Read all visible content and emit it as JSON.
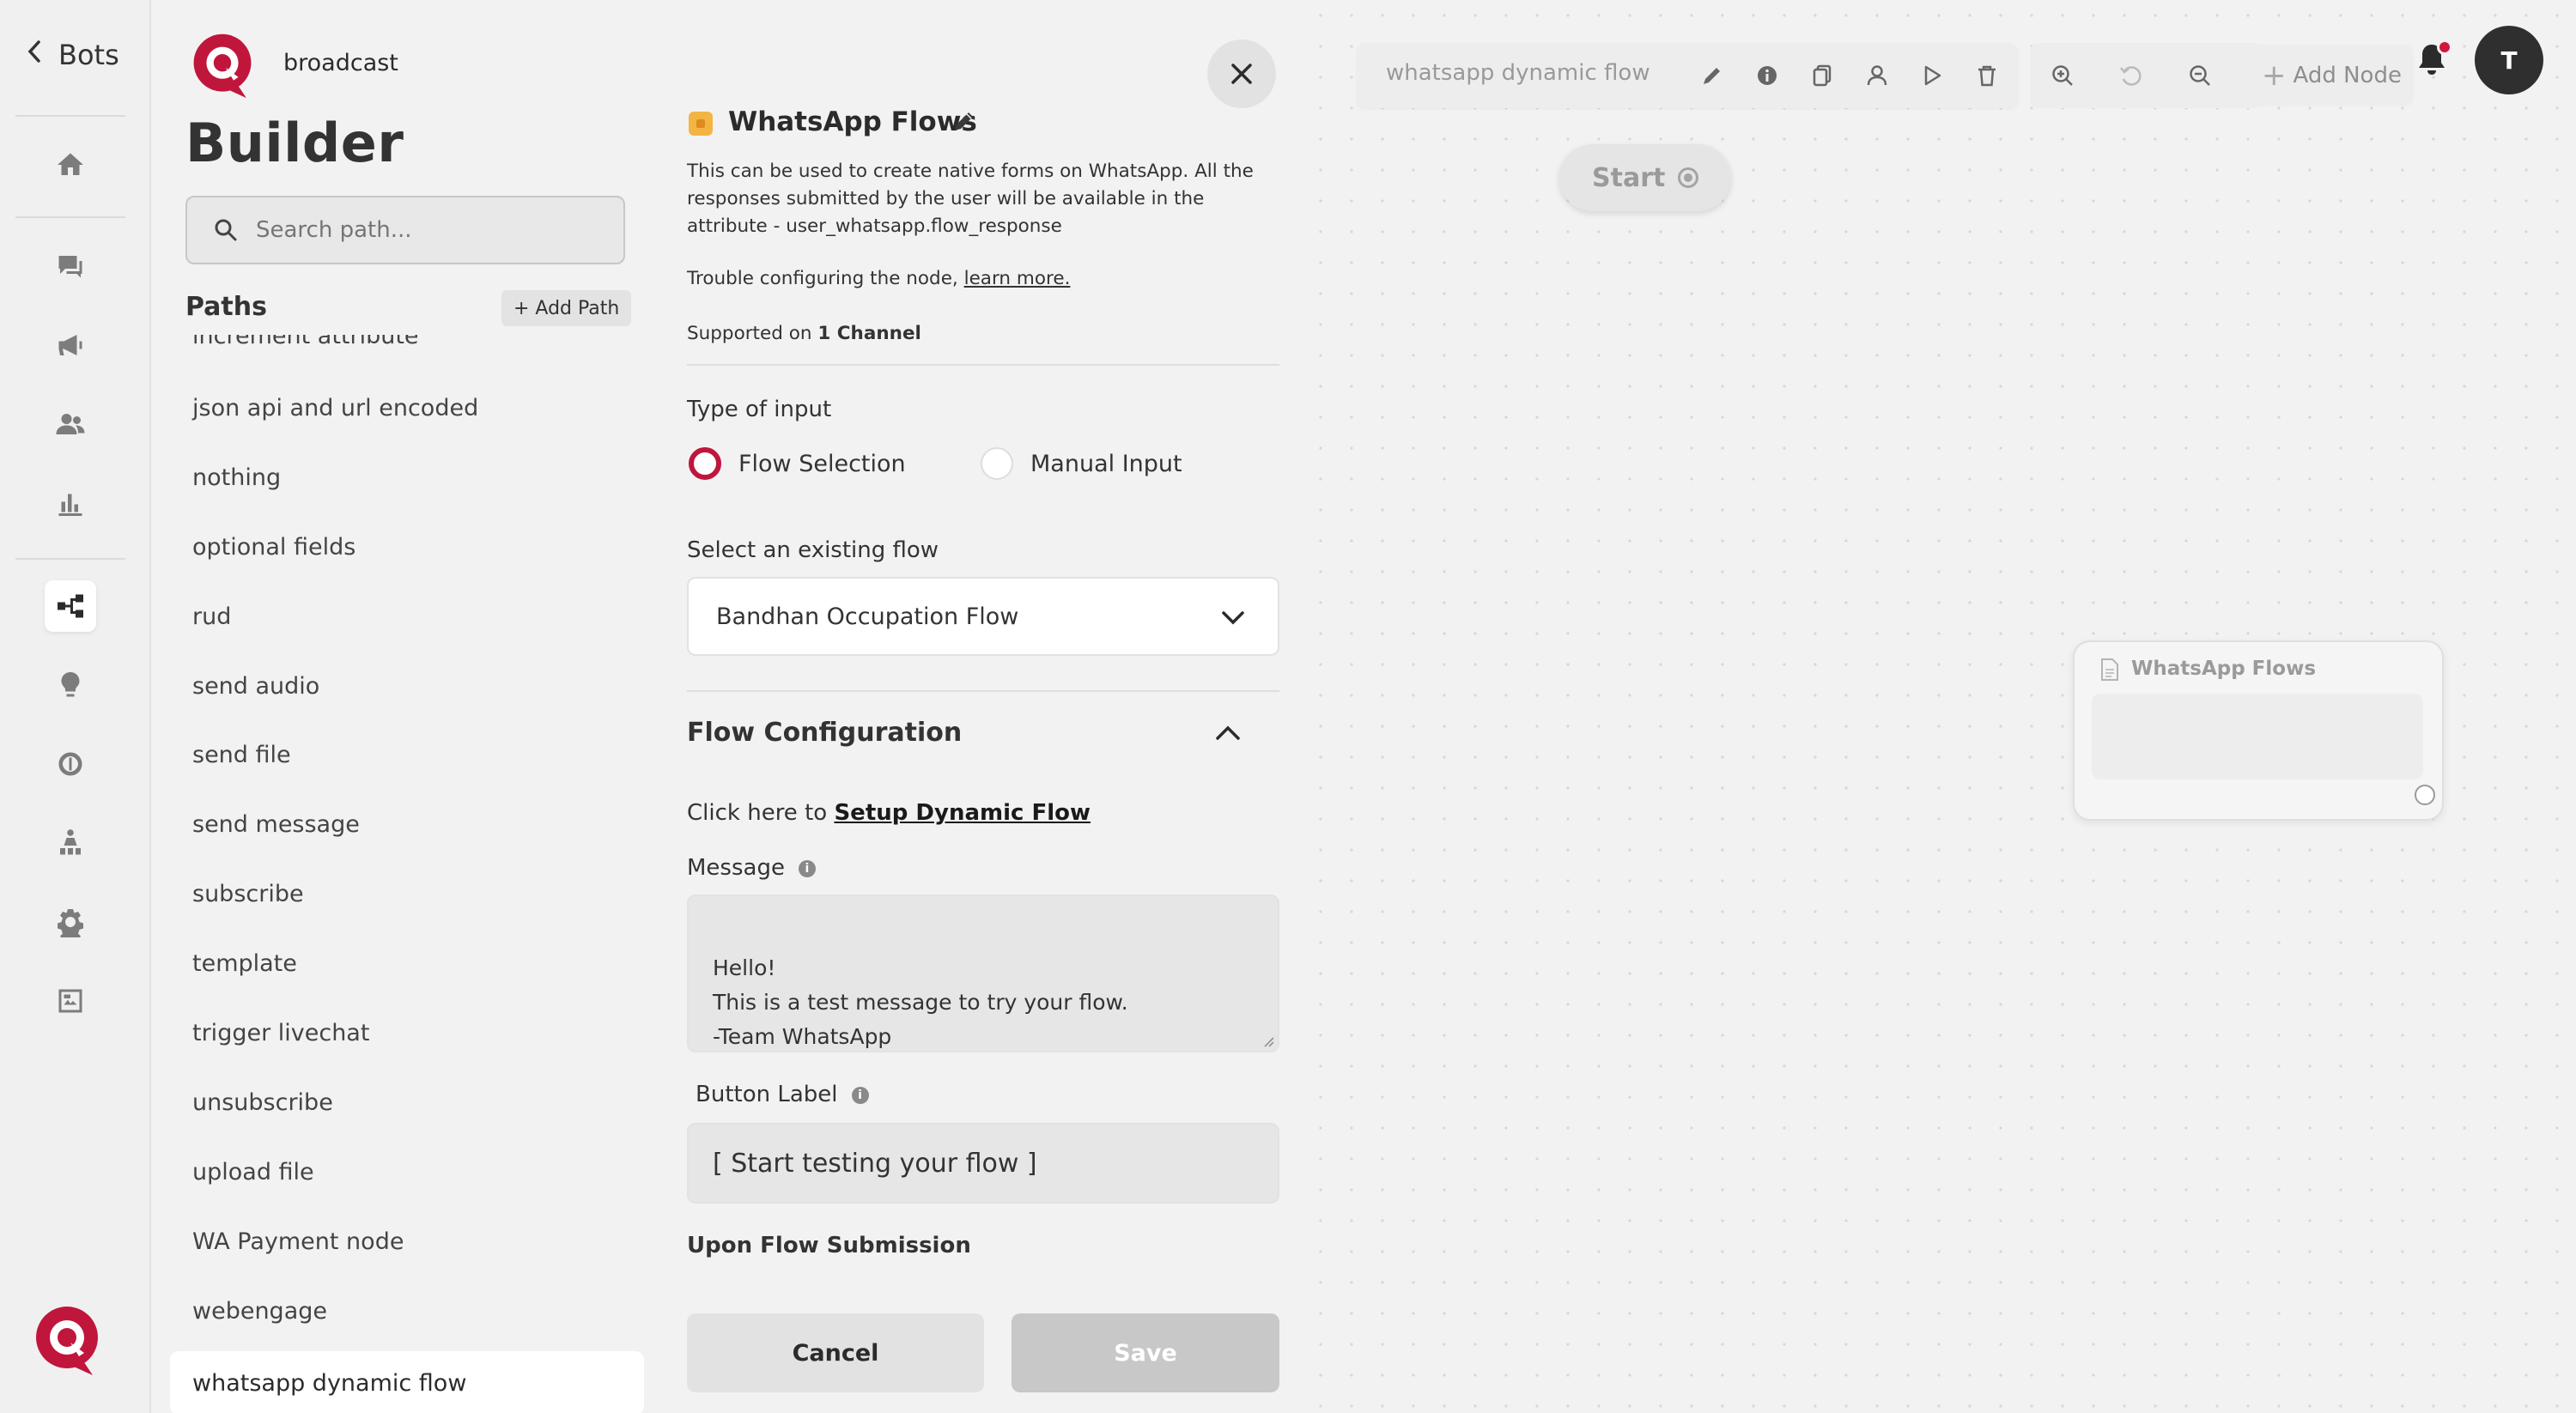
{
  "nav": {
    "back_label": "Bots",
    "bot_name": "broadcast",
    "rail_icons": [
      "home-icon",
      "chat-icon",
      "megaphone-icon",
      "users-icon",
      "bar-chart-icon",
      "flow-builder-icon",
      "bulb-icon",
      "brain-icon",
      "hierarchy-icon",
      "gear-icon",
      "image-swap-icon"
    ],
    "active_icon": "flow-builder-icon"
  },
  "sidebar": {
    "heading": "Builder",
    "search_placeholder": "Search path...",
    "paths_title": "Paths",
    "add_path_label": "+ Add Path",
    "items": [
      "increment attribute",
      "json api and url encoded",
      "nothing",
      "optional fields",
      "rud",
      "send audio",
      "send file",
      "send message",
      "subscribe",
      "template",
      "trigger livechat",
      "unsubscribe",
      "upload file",
      "WA Payment node",
      "webengage",
      "whatsapp dynamic flow"
    ],
    "selected": "whatsapp dynamic flow"
  },
  "panel": {
    "title": "WhatsApp Flows",
    "description": "This can be used to create native forms on WhatsApp. All the responses submitted by the user will be available in the attribute - user_whatsapp.flow_response",
    "trouble_text": "Trouble configuring the node,",
    "learn_more": "learn more.",
    "supported_prefix": "Supported on",
    "supported_channels": "1 Channel",
    "input_type_label": "Type of input",
    "radio_options": [
      "Flow Selection",
      "Manual Input"
    ],
    "radio_selected": "Flow Selection",
    "select_flow_label": "Select an existing flow",
    "selected_flow": "Bandhan Occupation Flow",
    "flow_config_title": "Flow Configuration",
    "setup_prefix": "Click here to",
    "setup_link": "Setup Dynamic Flow",
    "message_label": "Message",
    "message_value": "Hello!\nThis is a test message to try your flow.\n-Team WhatsApp",
    "button_label_label": "Button Label",
    "button_label_value": "[ Start testing your flow ]",
    "upon_submission_label": "Upon Flow Submission",
    "cancel_label": "Cancel",
    "save_label": "Save"
  },
  "canvas": {
    "flow_name": "whatsapp dynamic flow",
    "toolbar_icons": [
      "pencil-icon",
      "info-icon",
      "copy-icon",
      "user-icon",
      "play-icon",
      "trash-icon"
    ],
    "zoom_icons": [
      "zoom-in-icon",
      "reset-icon",
      "zoom-out-icon"
    ],
    "add_node_label": "Add Node",
    "avatar_initial": "T",
    "start_node_label": "Start",
    "node_title": "WhatsApp Flows"
  },
  "colors": {
    "brand": "#c0163c",
    "background": "#f3f2f3",
    "notification": "#d3163d"
  }
}
